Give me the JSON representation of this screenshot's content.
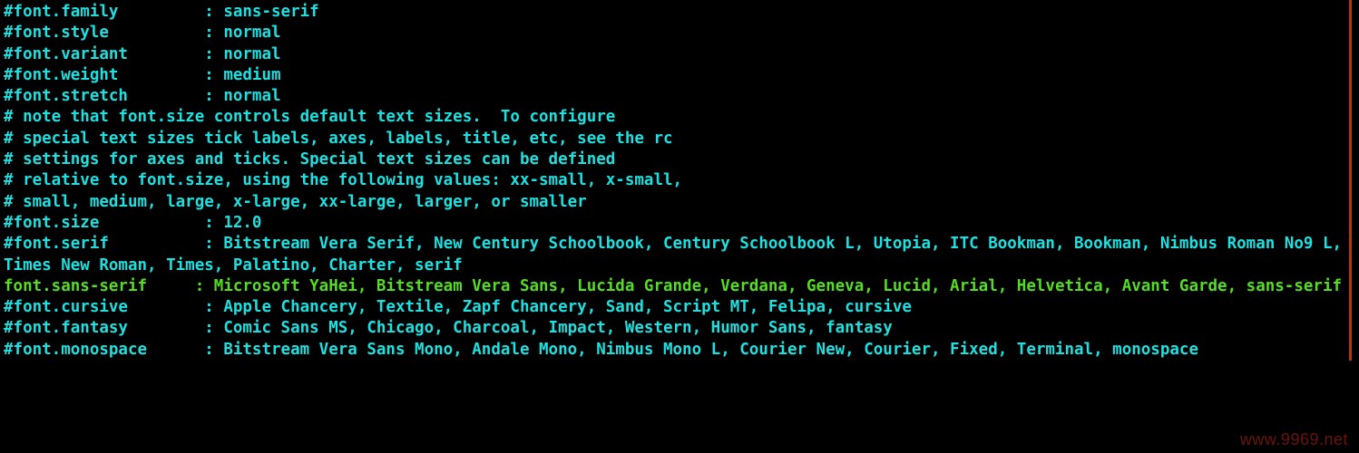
{
  "config_lines": {
    "l1": "#font.family         : sans-serif",
    "l2": "#font.style          : normal",
    "l3": "#font.variant        : normal",
    "l4": "#font.weight         : medium",
    "l5": "#font.stretch        : normal",
    "l6": "# note that font.size controls default text sizes.  To configure",
    "l7": "# special text sizes tick labels, axes, labels, title, etc, see the rc",
    "l8": "# settings for axes and ticks. Special text sizes can be defined",
    "l9": "# relative to font.size, using the following values: xx-small, x-small,",
    "l10": "# small, medium, large, x-large, xx-large, larger, or smaller",
    "l11": "#font.size           : 12.0",
    "l12": "#font.serif          : Bitstream Vera Serif, New Century Schoolbook, Century Schoolbook L, Utopia, ITC Bookman, Bookman, Nimbus Roman No9 L, Times New Roman, Times, Palatino, Charter, serif",
    "l13": "font.sans-serif     : Microsoft YaHei, Bitstream Vera Sans, Lucida Grande, Verdana, Geneva, Lucid, Arial, Helvetica, Avant Garde, sans-serif",
    "l14": "#font.cursive        : Apple Chancery, Textile, Zapf Chancery, Sand, Script MT, Felipa, cursive",
    "l15": "#font.fantasy        : Comic Sans MS, Chicago, Charcoal, Impact, Western, Humor Sans, fantasy",
    "l16": "#font.monospace      : Bitstream Vera Sans Mono, Andale Mono, Nimbus Mono L, Courier New, Courier, Fixed, Terminal, monospace"
  },
  "watermark": "www.9969.net"
}
